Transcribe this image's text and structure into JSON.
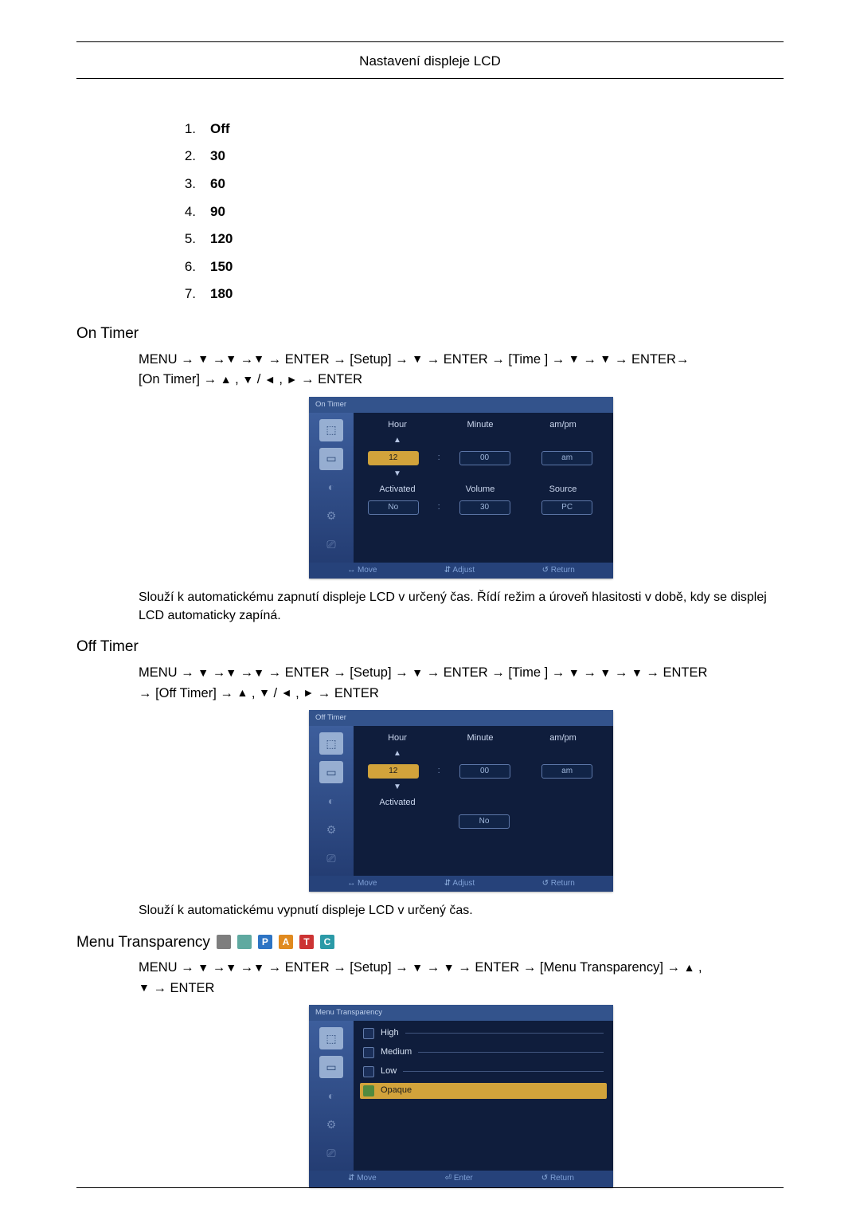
{
  "header": {
    "title": "Nastavení displeje LCD"
  },
  "list": [
    {
      "n": "1.",
      "v": "Off"
    },
    {
      "n": "2.",
      "v": "30"
    },
    {
      "n": "3.",
      "v": "60"
    },
    {
      "n": "4.",
      "v": "90"
    },
    {
      "n": "5.",
      "v": "120"
    },
    {
      "n": "6.",
      "v": "150"
    },
    {
      "n": "7.",
      "v": "180"
    }
  ],
  "sec_on": {
    "title": "On Timer",
    "path_1a": "MENU → ",
    "path_1b": " →",
    "path_1c": " →",
    "path_1d": " → ENTER → [Setup] → ",
    "path_1e": " → ENTER → [Time ] → ",
    "path_1f": "→ ",
    "path_1g": " → ENTER→",
    "path_2a": "[On Timer] → ",
    "path_2b": " , ",
    "path_2c": " / ",
    "path_2d": ", ",
    "path_2e": " → ENTER",
    "desc": "Slouží k automatickému zapnutí displeje LCD v určený čas. Řídí režim a úroveň hlasitosti v době, kdy se displej LCD automaticky zapíná."
  },
  "osd_on": {
    "title": "On Timer",
    "col1": "Hour",
    "col2": "Minute",
    "col3": "am/pm",
    "hour": "12",
    "minute": "00",
    "ampm": "am",
    "col4": "Activated",
    "col5": "Volume",
    "col6": "Source",
    "activated": "No",
    "volume": "30",
    "source": "PC",
    "move": "Move",
    "adjust": "Adjust",
    "ret": "Return"
  },
  "sec_off": {
    "title": "Off Timer",
    "path_1a": "MENU → ",
    "path_1b": " →",
    "path_1c": " →",
    "path_1d": " → ENTER → [Setup] → ",
    "path_1e": " → ENTER → [Time ] → ",
    "path_1f": "→ ",
    "path_1g": "→ ",
    "path_1h": " → ENTER",
    "path_2a": "→ [Off Timer] → ",
    "path_2b": " , ",
    "path_2c": " / ",
    "path_2d": ", ",
    "path_2e": " → ENTER",
    "desc": "Slouží k automatickému vypnutí displeje LCD v určený čas."
  },
  "osd_off": {
    "title": "Off Timer",
    "col1": "Hour",
    "col2": "Minute",
    "col3": "am/pm",
    "hour": "12",
    "minute": "00",
    "ampm": "am",
    "col4": "Activated",
    "activated": "No",
    "move": "Move",
    "adjust": "Adjust",
    "ret": "Return"
  },
  "sec_mt": {
    "title": "Menu Transparency",
    "pill1": " ",
    "pill2": " ",
    "pill3": "P",
    "pill4": "A",
    "pill5": "T",
    "pill6": "C",
    "path_1a": "MENU → ",
    "path_1b": " →",
    "path_1c": " →",
    "path_1d": " → ENTER → [Setup] → ",
    "path_1e": "→ ",
    "path_1f": " → ENTER → [Menu Transparency] → ",
    "path_1g": " ,",
    "path_2a": " → ENTER"
  },
  "osd_mt": {
    "title": "Menu Transparency",
    "opt1": "High",
    "opt2": "Medium",
    "opt3": "Low",
    "opt4": "Opaque",
    "move": "Move",
    "enter": "Enter",
    "ret": "Return"
  }
}
